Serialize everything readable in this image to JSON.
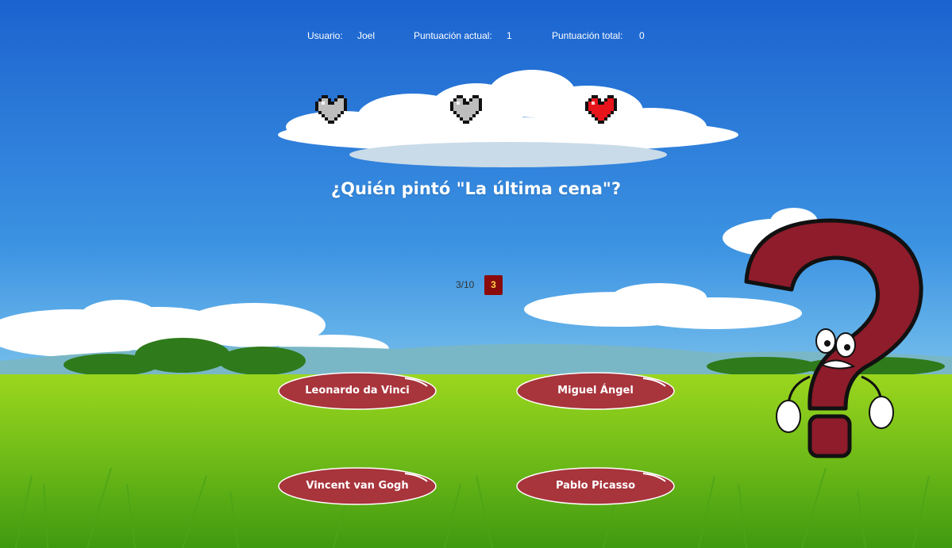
{
  "hud": {
    "user_label": "Usuario:",
    "user_value": "Joel",
    "current_label": "Puntuación actual:",
    "current_value": "1",
    "total_label": "Puntuación total:",
    "total_value": "0"
  },
  "lives": {
    "total": 3,
    "remaining": 1
  },
  "question": "¿Quién pintó \"La última cena\"?",
  "progress": {
    "text": "3/10",
    "current": 3,
    "total": 10
  },
  "timer": "3",
  "answers": [
    "Leonardo da Vinci",
    "Miguel Ángel",
    "Vincent van Gogh",
    "Pablo Picasso"
  ],
  "colors": {
    "answer_button": "#a8343c",
    "timer_bg": "#8a0b0b",
    "timer_text": "#ffd24a",
    "heart_full": "#e8141c",
    "heart_empty": "#bdbdbd",
    "mascot": "#8e1c2a"
  }
}
